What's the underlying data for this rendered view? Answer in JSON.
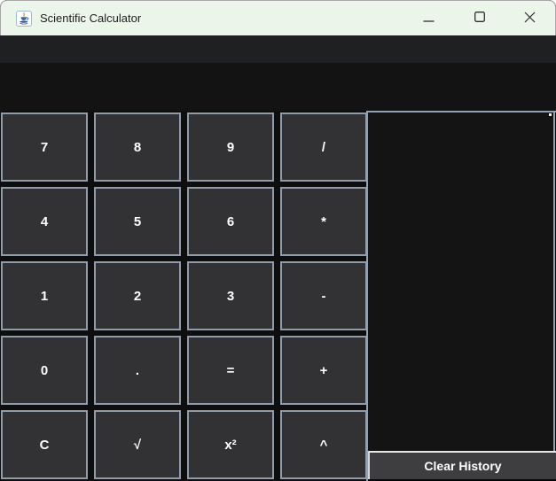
{
  "titlebar": {
    "title": "Scientific Calculator",
    "app_icon": "java-coffee-cup"
  },
  "window_controls": {
    "minimize_icon": "minimize-dash",
    "maximize_icon": "maximize-square",
    "close_icon": "close-x"
  },
  "display": {
    "value": "",
    "expression": ""
  },
  "keypad": {
    "rows": [
      [
        "7",
        "8",
        "9",
        "/"
      ],
      [
        "4",
        "5",
        "6",
        "*"
      ],
      [
        "1",
        "2",
        "3",
        "-"
      ],
      [
        "0",
        ".",
        "=",
        "+"
      ],
      [
        "C",
        "√",
        "x²",
        "^"
      ]
    ]
  },
  "history": {
    "entries": [],
    "clear_button_label": "Clear History"
  },
  "colors": {
    "titlebar_bg": "#ecf5ea",
    "title_text": "#1d1d1d",
    "display_field_bg": "#1f2021",
    "display_panel_bg": "#131314",
    "keypad_bg": "#0e0e0f",
    "key_bg": "#323234",
    "key_border": "#8f9dab",
    "key_text": "#ffffff",
    "history_bg": "#141414",
    "history_border": "#93a1ae",
    "clear_button_bg": "#3e3e40",
    "window_border": "#a8a8a8"
  }
}
